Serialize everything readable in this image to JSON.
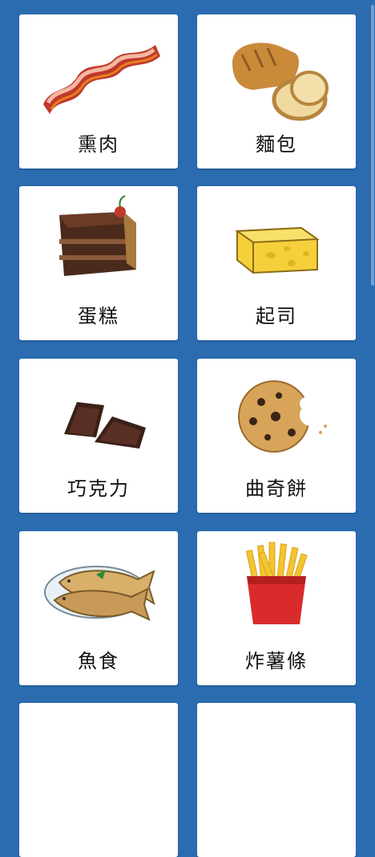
{
  "items": [
    {
      "label": "熏肉",
      "icon": "bacon-icon"
    },
    {
      "label": "麵包",
      "icon": "bread-icon"
    },
    {
      "label": "蛋糕",
      "icon": "cake-icon"
    },
    {
      "label": "起司",
      "icon": "cheese-icon"
    },
    {
      "label": "巧克力",
      "icon": "chocolate-icon"
    },
    {
      "label": "曲奇餅",
      "icon": "cookie-icon"
    },
    {
      "label": "魚食",
      "icon": "fish-icon"
    },
    {
      "label": "炸薯條",
      "icon": "fries-icon"
    }
  ],
  "colors": {
    "background": "#2b6cb0",
    "card": "#ffffff"
  }
}
